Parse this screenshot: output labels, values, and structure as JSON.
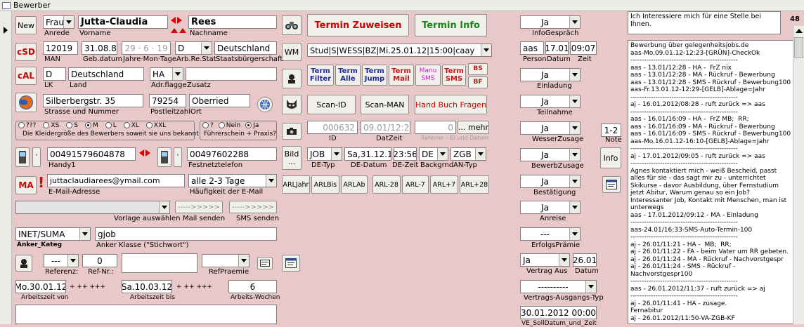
{
  "window": {
    "title": "Bewerber"
  },
  "c1": {
    "new": "New",
    "csd": "cSD",
    "cal": "cAL",
    "ma": "MA"
  },
  "p": {
    "anrede": "Frau",
    "anrede_lbl": "Anrede",
    "vorname": "Jutta-Claudia",
    "vorname_lbl": "Vorname",
    "nachname": "Rees",
    "nachname_lbl": "Nachname",
    "man": "12019",
    "man_lbl": "MAN",
    "geb": "31.08.83",
    "geb_lbl": "Geb.datum",
    "jmt": "29 · 6 · 19",
    "jmt_lbl": "Jahre·Mon·Tage",
    "arb": "D",
    "arb_lbl": "Arb.Re.Stat",
    "staat": "Deutschland",
    "staat_lbl": "Staatsbürgerschaft",
    "lk": "D",
    "lk_lbl": "LK",
    "land": "Deutschland",
    "land_lbl": "Land",
    "flag": "HA",
    "flag_lbl": "Adr.flagge",
    "zusatz": "",
    "zusatz_lbl": "Zusatz",
    "str": "Silberbergstr. 35",
    "str_lbl": "Strasse und Nummer",
    "plz": "79254",
    "plz_lbl": "Postleitzahl",
    "ort": "Oberried",
    "ort_lbl": "Ort"
  },
  "sizes": {
    "opts": [
      "???",
      "XS",
      "S",
      "M",
      "L",
      "XL",
      "XXL"
    ],
    "caption": "Die Kleidergröße des Bewerbers soweit sie uns bekannt ist"
  },
  "fuehr": {
    "opts": [
      "?",
      "Nein",
      "Ja"
    ],
    "caption": "Führerschein + Praxis?"
  },
  "tel": {
    "h1": "00491579604878",
    "h1_lbl": "Handy1",
    "fest": "00497602288",
    "fest_lbl": "Festnetztelefon"
  },
  "mail": {
    "addr": "juttaclaudiarees@ymail.com",
    "addr_lbl": "E-Mail-Adresse",
    "freq": "alle 2-3 Tage",
    "freq_lbl": "Häufigkeit der E-Mail"
  },
  "vorlage": {
    "lbl": "Vorlage auswählen",
    "mail_btn": "----->>>>>",
    "mail_lbl": "Mail senden",
    "sms_btn": "----->>>>>",
    "sms_lbl": "SMS senden"
  },
  "anker": {
    "kat": "INET/SUMA",
    "kat_lbl": "Anker_Kateg",
    "kl": "gjob",
    "kl_lbl": "Anker Klasse (\"Stichwort\")"
  },
  "ref": {
    "sel": "---",
    "lbl": "Referenz:",
    "nr": "0",
    "nr_lbl": "Ref-Nr.:",
    "praemie_lbl": "RefPraemie"
  },
  "az": {
    "von": "Mo.30.01.12",
    "von_lbl": "Arbeitszeit von",
    "bis": "Sa.10.03.12",
    "bis_lbl": "Arbeitszeit bis",
    "plus": "+ ++ +++",
    "wochen": "6",
    "wochen_lbl": "Arbeits-Wochen"
  },
  "mid": {
    "termin_zuweisen": "Termin Zuweisen",
    "termin_info": "Termin Info",
    "wm": "WM",
    "wm_val": "Stud|S|WESS|BZ|Mi.25.01.12|15:00|caay",
    "tf": "Term Filter",
    "ta": "Term Alle",
    "tj": "Term Jump",
    "tm": "Term Mail",
    "ms": "Manu SMS",
    "ts": "Term SMS",
    "bs": "BS",
    "bf": "BF",
    "scanid": "Scan-ID",
    "scanman": "Scan-MAN",
    "handbuch": "Hand Buch Fragen",
    "id": "000632",
    "id_lbl": "ID",
    "datzeit": "09.01/12:22",
    "datzeit_lbl": "DatZeit",
    "ref0": "0",
    "ref_lbl": "Referrer - ID und Datum",
    "mehr": "... mehr",
    "bild": "Bild ...",
    "de_typ": "JOB",
    "de_typ_lbl": "DE-Typ",
    "de_datum": "Sa,31.12.11",
    "de_datum_lbl": "DE-Datum",
    "de_zeit": "23:56",
    "de_zeit_lbl": "DE-Zeit",
    "backgrnd": "DE",
    "backgrnd_lbl": "Backgrnd",
    "an_typ": "ZGB",
    "an_typ_lbl": "AN-Typ",
    "arl": [
      "ARLJahr",
      "ARLBis",
      "ARLAb",
      "ARL-28",
      "ARL-7",
      "ARL+7",
      "ARL+28"
    ]
  },
  "right": {
    "info": "Ja",
    "info_lbl": "InfoGespräch",
    "person": "aas",
    "person_lbl": "Person",
    "datum": "17.01",
    "datum_lbl": "Datum",
    "zeit": "09:07",
    "zeit_lbl": "Zeit",
    "einladung": "Ja",
    "einladung_lbl": "Einladung",
    "teilnahme": "Ja",
    "teilnahme_lbl": "Teilnahme",
    "wesser": "Ja",
    "wesser_lbl": "WesserZusage",
    "note": "1-2",
    "note_lbl": "Note",
    "bewerb": "Ja",
    "bewerb_lbl": "BewerbZusage",
    "info_btn": "Info",
    "best": "Ja",
    "best_lbl": "Bestätigung",
    "anreise": "Ja",
    "anreise_lbl": "Anreise",
    "erfolg": "---",
    "erfolg_lbl": "ErfolgsPrämie",
    "vertrag": "Ja",
    "vertrag_lbl": "Vertrag Aus",
    "vdatum": "26.01",
    "vdatum_lbl": "Datum",
    "vat": "----------",
    "vat_lbl": "Vertrags-Ausgangs-Typ",
    "ve": "30.01.2012 00:00",
    "ve_lbl": "VE_SollDatum_und_Zeit"
  },
  "notes": {
    "top": "Ich Interessiere mich für eine Stelle bei Ihnen.",
    "count": "48",
    "log": "Bewerbung über gelegenheitsjobs.de\naas-Mo.09.01.12-12:23-[GRÜN]-CheckOk\n-----------------------------------------------\naas - 13.01/12:28 - HA -  FrZ nix\naas - 13.01/12:28 - MA - Rückruf - Bewerbung\naas - 13.01/12:28 - SMS - Rückruf - Bewerbung100\naas-Fr.13.01.12-12:29-[GELB]-Ablage=Jahr\n-----------------------------------------------\naj - 16.01.2012/08:28 - ruft zurück => aas\n-----------------------------------------------\naas - 16.01/16:09 - HA -  FrZ MB;  RR;\naas - 16.01/16:09 - MA - Rückruf - Bewerbung\naas - 16.01/16:09 - SMS - Rückruf - Bewerbung100\naas-Mo.16.01.12-16:10-[GELB]-Ablage=Jahr\n-----------------------------------------------\naj - 17.01.2012/09:05 - ruft zurück => aas\n-----------------------------------------------\nAgnes kontaktiert mich - weiß Bescheid, passt alles für sie - das sagt mir zu - unterrichtet Skikurse - davor Ausbildung, über Fernstudium jetzt Abitur, Warum genau so ein Job? Interessanter Job, Kontakt mit Menschen, man ist unterwegs\naas - 17.01.2012/09:12 - MA - Einladung\n-----------------------------------------------\naas-24.01/16:33-SMS-Auto-Termin-100\n-----------------------------------------------\naj - 26.01/11:21 - HA -  MB;  RR;\naj - 26.01/11:22 - FA - beim Vater um RR gebeten.\naj - 26.01/11:24 - MA - Rückruf - Nachvorstgespr\naj - 26.01/11:24 - SMS - Rückruf - Nachvorstgespr100\n-----------------------------------------------\naas - 26.01.2012/11:37 - ruft zurück => aj\n-----------------------------------------------\naj - 26.01/11:41 - HA - zusage.\nFernabitur\naj - 26.01.2012/11:50-VA-ZGB-KF"
  }
}
